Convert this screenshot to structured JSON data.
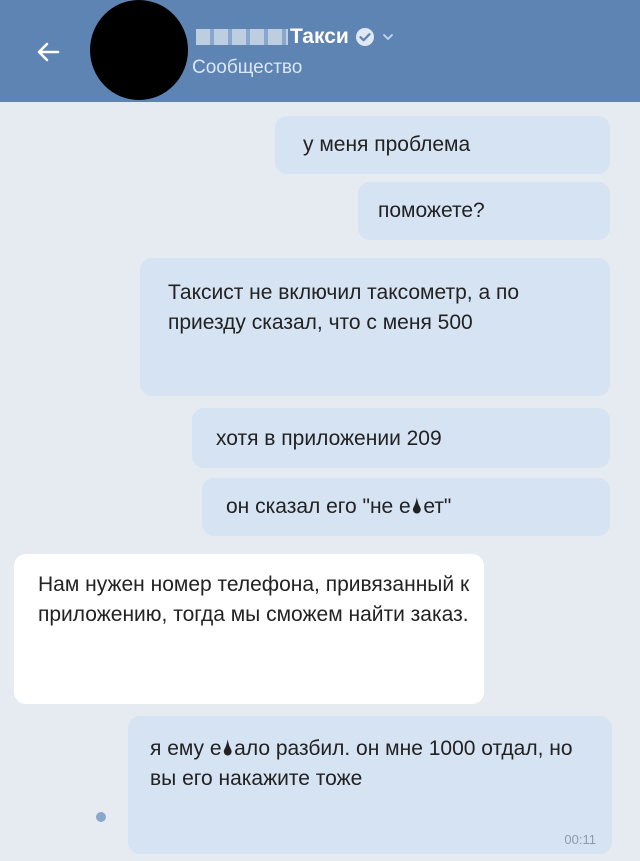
{
  "header": {
    "title": "Такси",
    "subtitle": "Сообщество"
  },
  "messages": [
    {
      "text": "у меня проблема",
      "direction": "outgoing"
    },
    {
      "text": "поможете?",
      "direction": "outgoing"
    },
    {
      "text": "Таксист не включил таксометр, а по приезду сказал, что с меня 500",
      "direction": "outgoing"
    },
    {
      "text": "хотя в приложении 209",
      "direction": "outgoing"
    },
    {
      "text": "он сказал его \"не е🌢ет\"",
      "direction": "outgoing"
    },
    {
      "text": "Нам нужен номер телефона, привязанный к приложению, тогда мы сможем найти заказ.",
      "direction": "incoming"
    },
    {
      "text": "я ему е🌢ало разбил. он мне 1000 отдал, но вы его накажите тоже",
      "direction": "outgoing",
      "time": "00:11"
    }
  ],
  "colors": {
    "header": "#5e84b3",
    "chat_background": "#e6ebf1",
    "outgoing_bubble": "#d6e3f2",
    "incoming_bubble": "#ffffff"
  },
  "icons": {
    "back": "back-arrow-icon",
    "verified": "verified-check-icon",
    "menu": "chevron-down-icon"
  }
}
